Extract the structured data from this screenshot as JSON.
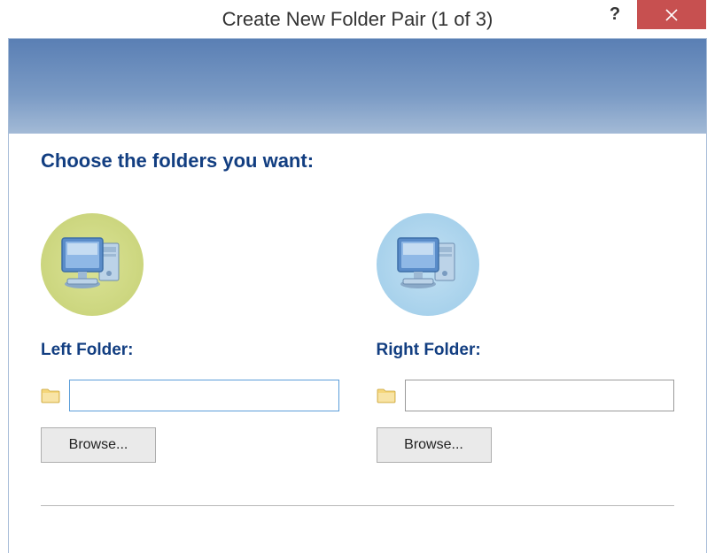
{
  "titlebar": {
    "title": "Create New Folder Pair (1 of 3)",
    "help": "?",
    "close": "×"
  },
  "heading": "Choose the folders you want:",
  "left": {
    "label": "Left Folder:",
    "value": "",
    "browse": "Browse..."
  },
  "right": {
    "label": "Right Folder:",
    "value": "",
    "browse": "Browse..."
  }
}
